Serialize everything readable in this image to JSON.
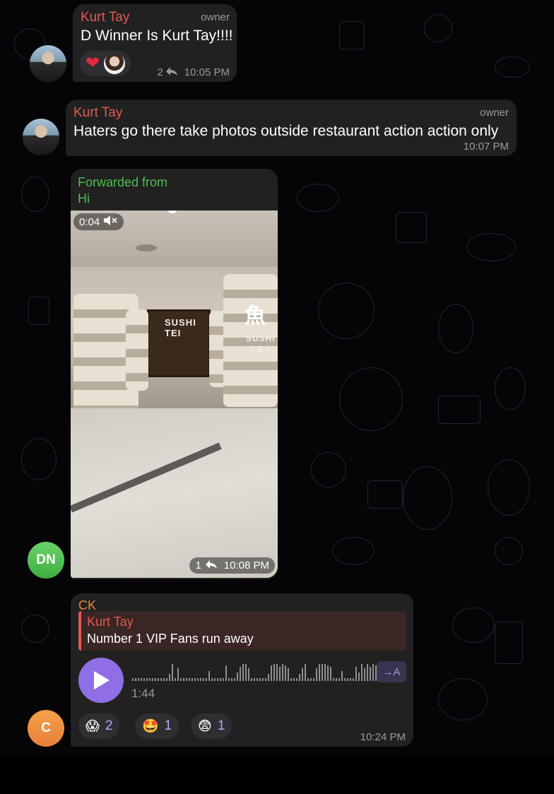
{
  "messages": [
    {
      "sender": "Kurt Tay",
      "role": "owner",
      "text": "D Winner Is Kurt Tay!!!!",
      "reactions": {
        "reply_count": "2",
        "time": "10:05 PM"
      }
    },
    {
      "sender": "Kurt Tay",
      "role": "owner",
      "text": "Haters go there take photos outside restaurant action action only",
      "time": "10:07 PM"
    },
    {
      "forwarded_label": "Forwarded from",
      "forwarded_name": "Hi",
      "video": {
        "duration": "0:04",
        "sign_text": "SUSHI TEI",
        "pillar_sign_top": "SUSHI",
        "pillar_sign_bottom": "T E I"
      },
      "reply_count": "1",
      "time": "10:08 PM",
      "avatar_initials": "DN"
    },
    {
      "sender": "CK",
      "reply": {
        "sender": "Kurt Tay",
        "text": "Number 1 VIP Fans run away"
      },
      "voice": {
        "duration": "1:44",
        "transcribe_label": "→A"
      },
      "reactions": [
        {
          "emoji": "😱",
          "count": "2"
        },
        {
          "emoji": "🤩",
          "count": "1"
        },
        {
          "emoji": "😨",
          "count": "1"
        }
      ],
      "time": "10:24 PM",
      "avatar_initials": "C"
    }
  ],
  "icons": {
    "heart": "❤",
    "reply": "reply-arrow-icon",
    "mute": "muted-speaker-icon",
    "play": "play-icon"
  },
  "colors": {
    "accent_red": "#e05a4f",
    "forward_green": "#4fbe4f",
    "ck_orange": "#e8893a",
    "play_purple": "#8f6ee6",
    "bubble": "#212121"
  }
}
